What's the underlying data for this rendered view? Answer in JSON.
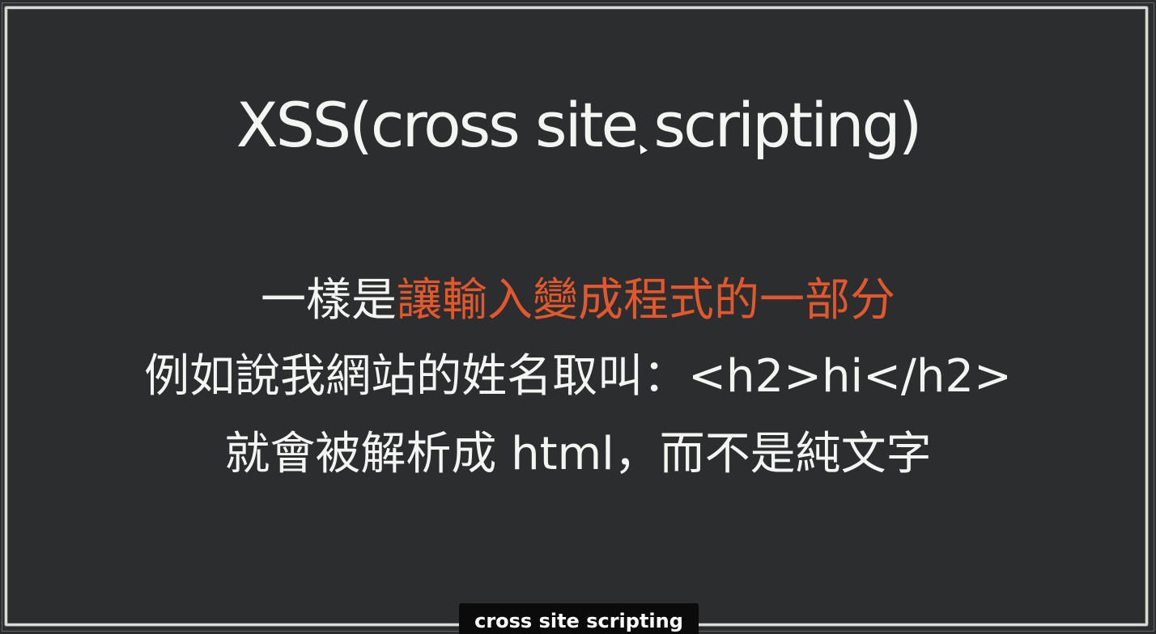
{
  "slide": {
    "title": "XSS(cross site scripting)",
    "line1_prefix": "一樣是",
    "line1_accent": "讓輸入變成程式的一部分",
    "line2": "例如說我網站的姓名取叫：<h2>hi</h2>",
    "line3": "就會被解析成 html，而不是純文字"
  },
  "subtitle": {
    "text": "cross site scripting"
  },
  "colors": {
    "background": "#2c2d2f",
    "text": "#f4f4f2",
    "accent": "#e2572b"
  },
  "icons": {
    "cursor": "mouse-pointer-icon"
  }
}
